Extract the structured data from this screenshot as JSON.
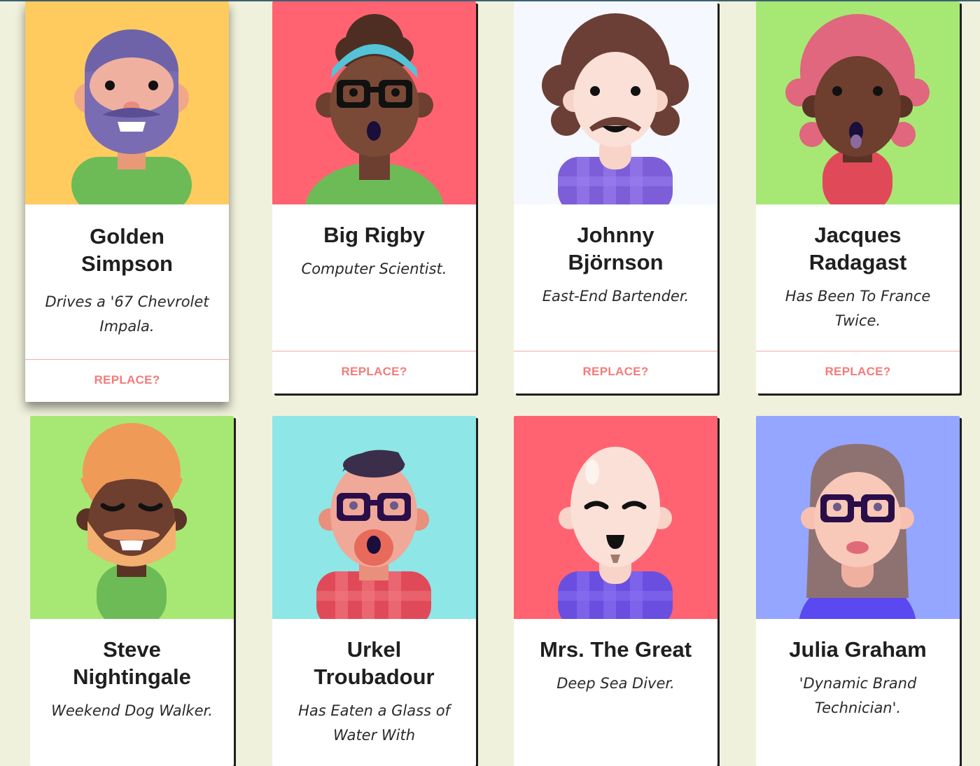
{
  "replace_label": "REPLACE?",
  "cards": [
    {
      "name": "Golden Simpson",
      "bio": "Drives a '67 Chevrolet Impala.",
      "bg": "#ffcb5e"
    },
    {
      "name": "Big Rigby",
      "bio": "Computer Scientist.",
      "bg": "#ff6372"
    },
    {
      "name": "Johnny Björnson",
      "bio": "East-End Bartender.",
      "bg": "#f5f8ff"
    },
    {
      "name": "Jacques Radagast",
      "bio": "Has Been To France Twice.",
      "bg": "#a7e874"
    },
    {
      "name": "Steve Nightingale",
      "bio": "Weekend Dog Walker.",
      "bg": "#a7e874"
    },
    {
      "name": "Urkel Troubadour",
      "bio": "Has Eaten a Glass of Water With",
      "bg": "#8ee6e6"
    },
    {
      "name": "Mrs. The Great",
      "bio": "Deep Sea Diver.",
      "bg": "#ff6372"
    },
    {
      "name": "Julia Graham",
      "bio": "'Dynamic Brand Technician'.",
      "bg": "#94a6ff"
    }
  ]
}
